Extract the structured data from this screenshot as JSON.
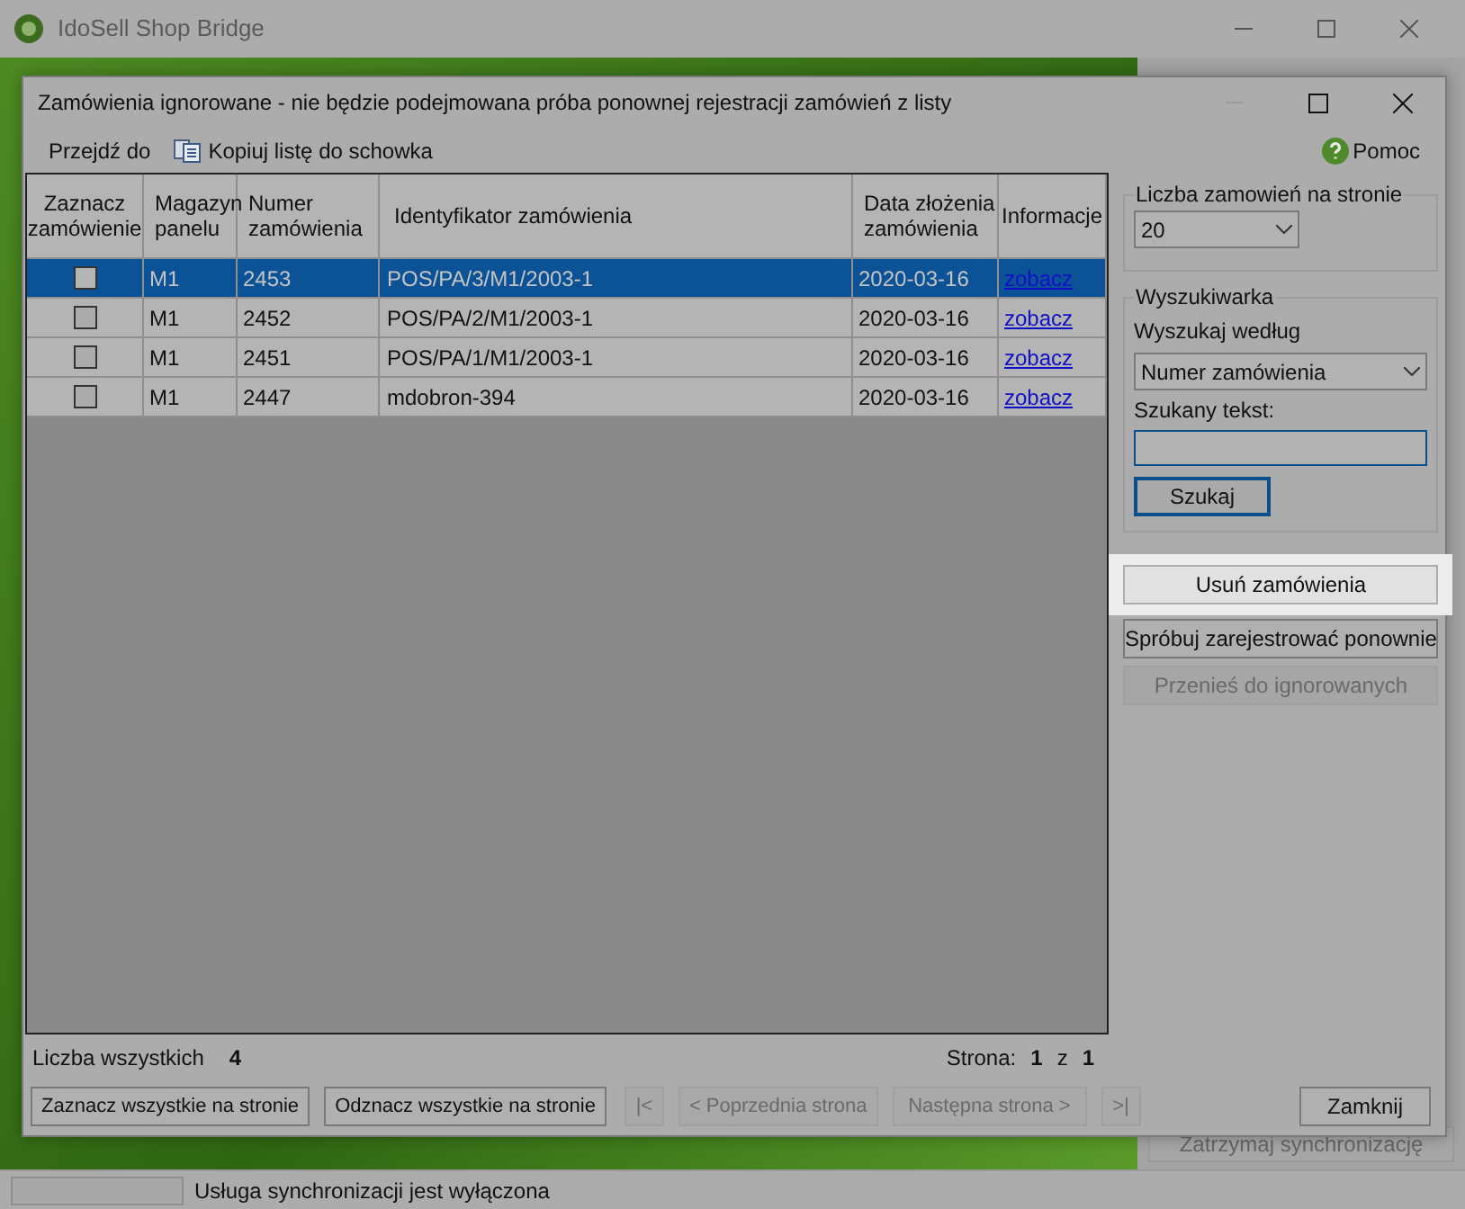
{
  "app": {
    "title": "IdoSell Shop Bridge",
    "stop_button": {
      "label": "Zatrzymaj synchronizację",
      "disabled": true
    },
    "status_bar": {
      "text": "Usługa synchronizacji jest wyłączona"
    }
  },
  "dialog": {
    "title": "Zamówienia ignorowane - nie będzie podejmowana próba ponownej rejestracji zamówień z listy",
    "toolbar": [
      {
        "label": "Przejdź do",
        "kind": "text"
      },
      {
        "label": "Kopiuj listę do schowka",
        "kind": "copy"
      }
    ],
    "help": "Pomoc",
    "table": {
      "columns": [
        "Zaznacz zamówienie",
        "Magazyn panelu",
        "Numer zamówienia",
        "Identyfikator zamówienia",
        "Data złożenia zamówienia",
        "Informacje"
      ],
      "rows": [
        {
          "selected": true,
          "checked": false,
          "warehouse": "M1",
          "number": "2453",
          "id": "POS/PA/3/M1/2003-1",
          "date": "2020-03-16",
          "info": "zobacz"
        },
        {
          "selected": false,
          "checked": false,
          "warehouse": "M1",
          "number": "2452",
          "id": "POS/PA/2/M1/2003-1",
          "date": "2020-03-16",
          "info": "zobacz"
        },
        {
          "selected": false,
          "checked": false,
          "warehouse": "M1",
          "number": "2451",
          "id": "POS/PA/1/M1/2003-1",
          "date": "2020-03-16",
          "info": "zobacz"
        },
        {
          "selected": false,
          "checked": false,
          "warehouse": "M1",
          "number": "2447",
          "id": "mdobron-394",
          "date": "2020-03-16",
          "info": "zobacz"
        }
      ]
    },
    "total_label": "Liczba wszystkich",
    "total": "4",
    "page_label": "Strona:",
    "page": "1",
    "page_sep": "z",
    "pages": "1",
    "footer_buttons": [
      {
        "label": "Zaznacz wszystkie na stronie",
        "disabled": false
      },
      {
        "label": "Odznacz wszystkie na stronie",
        "disabled": false
      },
      {
        "label": "|<",
        "disabled": true
      },
      {
        "label": "< Poprzednia strona",
        "disabled": true
      },
      {
        "label": "Następna strona >",
        "disabled": true
      },
      {
        "label": ">|",
        "disabled": true
      }
    ],
    "close_button": "Zamknij",
    "per_page": {
      "legend": "Liczba zamowień na stronie",
      "value": "20"
    },
    "search": {
      "legend": "Wyszukiwarka",
      "by_label": "Wyszukaj według",
      "by_value": "Numer zamówienia",
      "text_label": "Szukany tekst:",
      "button": "Szukaj"
    },
    "actions": [
      {
        "label": "Usuń zamówienia",
        "highlighted": true,
        "disabled": false
      },
      {
        "label": "Spróbuj zarejestrować ponownie",
        "highlighted": false,
        "disabled": false
      },
      {
        "label": "Przenieś do ignorowanych",
        "highlighted": false,
        "disabled": true
      }
    ]
  }
}
